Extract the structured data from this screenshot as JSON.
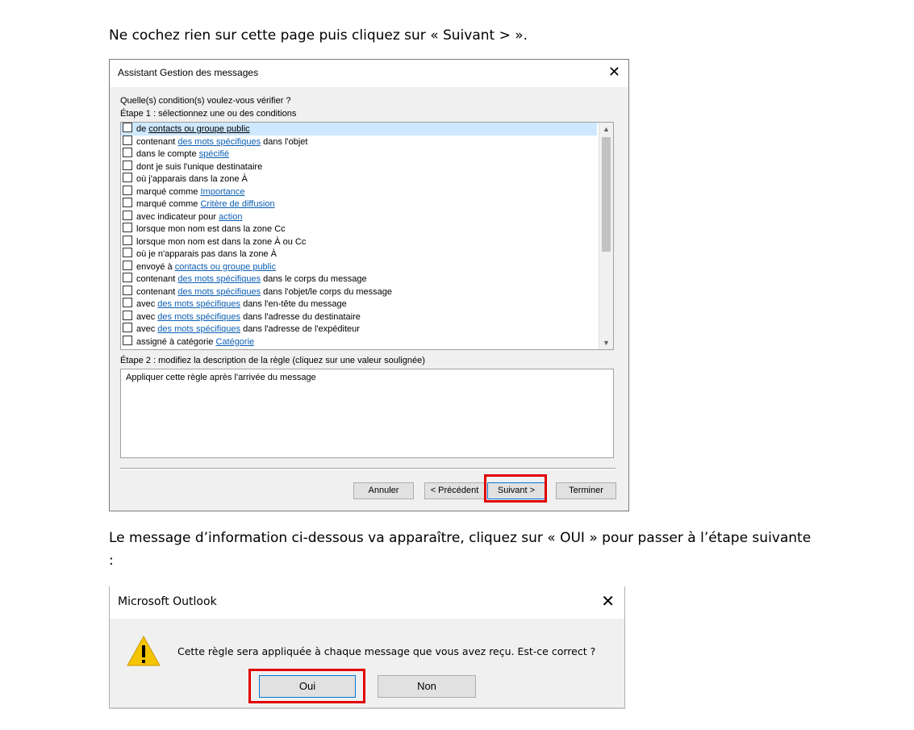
{
  "instructions": {
    "line1": "Ne cochez rien sur cette page puis cliquez sur « Suivant > ».",
    "line2": "Le message d’information ci-dessous va apparaître, cliquez sur « OUI » pour passer à l’étape suivante :"
  },
  "wizard": {
    "title": "Assistant Gestion des messages",
    "close_glyph": "✕",
    "question": "Quelle(s) condition(s) voulez-vous vérifier ?",
    "step1": "Étape 1 : sélectionnez une ou des conditions",
    "conditions": [
      {
        "pre": "de ",
        "link": "contacts ou groupe public",
        "post": ""
      },
      {
        "pre": "contenant ",
        "link": "des mots spécifiques",
        "post": " dans l'objet"
      },
      {
        "pre": "dans le compte ",
        "link": "spécifié",
        "post": ""
      },
      {
        "pre": "dont je suis l'unique destinataire",
        "link": "",
        "post": ""
      },
      {
        "pre": "où j'apparais dans la zone À",
        "link": "",
        "post": ""
      },
      {
        "pre": "marqué comme ",
        "link": "Importance",
        "post": ""
      },
      {
        "pre": "marqué comme ",
        "link": "Critère de diffusion",
        "post": ""
      },
      {
        "pre": "avec indicateur pour ",
        "link": "action",
        "post": ""
      },
      {
        "pre": "lorsque mon nom est dans la zone Cc",
        "link": "",
        "post": ""
      },
      {
        "pre": "lorsque mon nom est dans la zone À ou Cc",
        "link": "",
        "post": ""
      },
      {
        "pre": "où je n'apparais pas dans la zone À",
        "link": "",
        "post": ""
      },
      {
        "pre": "envoyé à ",
        "link": "contacts ou groupe public",
        "post": ""
      },
      {
        "pre": "contenant ",
        "link": "des mots spécifiques",
        "post": " dans le corps du message"
      },
      {
        "pre": "contenant ",
        "link": "des mots spécifiques",
        "post": " dans l'objet/le corps du message"
      },
      {
        "pre": "avec ",
        "link": "des mots spécifiques",
        "post": " dans l'en-tête du message"
      },
      {
        "pre": "avec ",
        "link": "des mots spécifiques",
        "post": " dans l'adresse du destinataire"
      },
      {
        "pre": "avec ",
        "link": "des mots spécifiques",
        "post": " dans l'adresse de l'expéditeur"
      },
      {
        "pre": "assigné à catégorie ",
        "link": "Catégorie",
        "post": ""
      }
    ],
    "step2": "Étape 2 : modifiez la description de la règle (cliquez sur une valeur soulignée)",
    "description": "Appliquer cette règle après l'arrivée du message",
    "buttons": {
      "cancel": "Annuler",
      "previous": "< Précédent",
      "next": "Suivant >",
      "finish": "Terminer"
    }
  },
  "msgbox": {
    "title": "Microsoft Outlook",
    "close_glyph": "✕",
    "text": "Cette règle sera appliquée à chaque message que vous avez reçu. Est-ce correct ?",
    "yes": "Oui",
    "no": "Non"
  },
  "colors": {
    "highlight_box": "#e00000",
    "link": "#0b5fb4",
    "focus_border": "#0078d7",
    "warning_yellow": "#f5c400"
  }
}
